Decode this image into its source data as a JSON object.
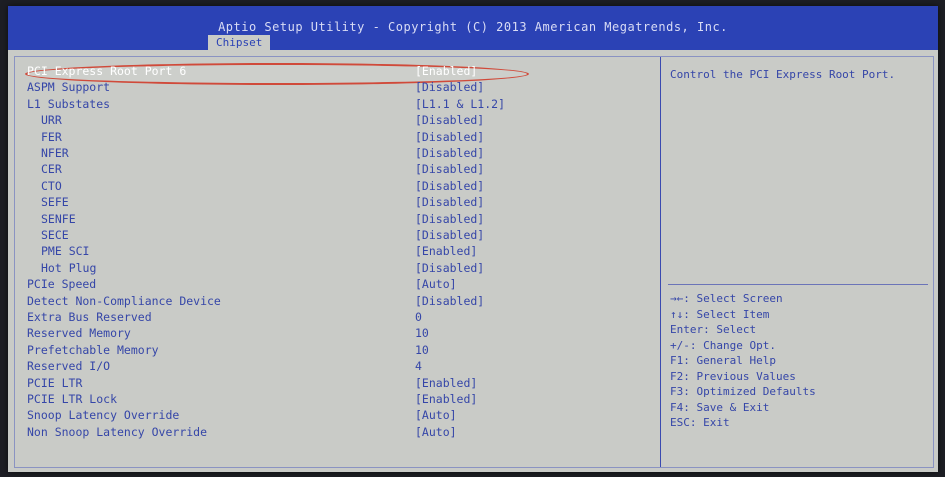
{
  "header": {
    "title": "Aptio Setup Utility - Copyright (C) 2013 American Megatrends, Inc.",
    "tab": "Chipset"
  },
  "settings": [
    {
      "label": "PCI Express Root Port 6",
      "value": "[Enabled]",
      "indent": 0,
      "selected": true
    },
    {
      "label": "ASPM Support",
      "value": "[Disabled]",
      "indent": 0
    },
    {
      "label": "L1 Substates",
      "value": "[L1.1 & L1.2]",
      "indent": 0
    },
    {
      "label": "URR",
      "value": "[Disabled]",
      "indent": 1
    },
    {
      "label": "FER",
      "value": "[Disabled]",
      "indent": 1
    },
    {
      "label": "NFER",
      "value": "[Disabled]",
      "indent": 1
    },
    {
      "label": "CER",
      "value": "[Disabled]",
      "indent": 1
    },
    {
      "label": "CTO",
      "value": "[Disabled]",
      "indent": 1
    },
    {
      "label": "SEFE",
      "value": "[Disabled]",
      "indent": 1
    },
    {
      "label": "SENFE",
      "value": "[Disabled]",
      "indent": 1
    },
    {
      "label": "SECE",
      "value": "[Disabled]",
      "indent": 1
    },
    {
      "label": "PME SCI",
      "value": "[Enabled]",
      "indent": 1
    },
    {
      "label": "Hot Plug",
      "value": "[Disabled]",
      "indent": 1
    },
    {
      "label": "PCIe Speed",
      "value": "[Auto]",
      "indent": 0
    },
    {
      "label": "Detect Non-Compliance Device",
      "value": "[Disabled]",
      "indent": 0
    },
    {
      "label": "Extra Bus Reserved",
      "value": "0",
      "indent": 0
    },
    {
      "label": "Reserved Memory",
      "value": "10",
      "indent": 0
    },
    {
      "label": "Prefetchable Memory",
      "value": "10",
      "indent": 0
    },
    {
      "label": "Reserved I/O",
      "value": "4",
      "indent": 0
    },
    {
      "label": "PCIE LTR",
      "value": "[Enabled]",
      "indent": 0
    },
    {
      "label": "PCIE LTR Lock",
      "value": "[Enabled]",
      "indent": 0
    },
    {
      "label": "Snoop Latency Override",
      "value": "[Auto]",
      "indent": 0
    },
    {
      "label": "Non Snoop Latency Override",
      "value": "[Auto]",
      "indent": 0
    }
  ],
  "help": {
    "text": "Control the PCI Express Root Port."
  },
  "keys": [
    "→←: Select Screen",
    "↑↓: Select Item",
    "Enter: Select",
    "+/-: Change Opt.",
    "F1: General Help",
    "F2: Previous Values",
    "F3: Optimized Defaults",
    "F4: Save & Exit",
    "ESC: Exit"
  ],
  "colors": {
    "header_bg": "#2b42b5",
    "panel_bg": "#c9cbc7",
    "text": "#3546a8",
    "selected_text": "#ffffff",
    "annotation": "#d04a3a"
  }
}
